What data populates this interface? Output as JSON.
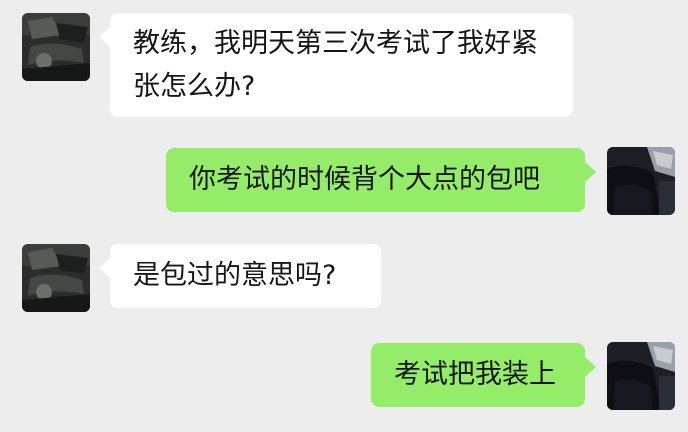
{
  "messages": [
    {
      "side": "in",
      "lines": [
        "教练，我明天第三次考试了我好紧",
        "张怎么办?"
      ]
    },
    {
      "side": "out",
      "lines": [
        "你考试的时候背个大点的包吧"
      ]
    },
    {
      "side": "in",
      "lines": [
        "是包过的意思吗?"
      ]
    },
    {
      "side": "out",
      "lines": [
        "考试把我装上"
      ]
    }
  ],
  "colors": {
    "background": "#ededed",
    "incoming_bubble": "#ffffff",
    "outgoing_bubble": "#95ec69",
    "text": "#161616"
  }
}
